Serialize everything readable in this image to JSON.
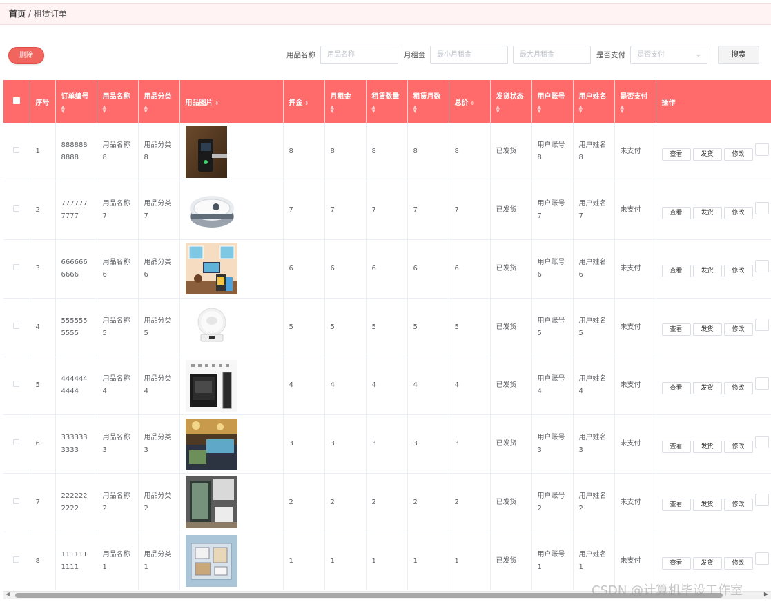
{
  "breadcrumb": {
    "home": "首页",
    "separator": " / ",
    "current": "租赁订单"
  },
  "toolbar": {
    "delete_label": "删除",
    "filters": [
      {
        "label": "用品名称",
        "placeholder": "用品名称"
      },
      {
        "label": "月租金",
        "min_placeholder": "最小月租金",
        "max_placeholder": "最大月租金"
      },
      {
        "label": "是否支付",
        "placeholder": "是否支付"
      }
    ],
    "search_label": "搜索"
  },
  "table": {
    "headers": [
      "序号",
      "订单编号",
      "用品名称",
      "用品分类",
      "用品图片",
      "押金",
      "月租金",
      "租赁数量",
      "租赁月数",
      "总价",
      "发货状态",
      "用户账号",
      "用户姓名",
      "是否支付",
      "操作"
    ],
    "actions": [
      "查看",
      "发货",
      "修改"
    ],
    "rows": [
      {
        "index": "1",
        "order_no": "8888888888",
        "name": "用品名称8",
        "category": "用品分类8",
        "image": "smart-door-lock",
        "deposit": "8",
        "monthly_rent": "8",
        "qty": "8",
        "months": "8",
        "total": "8",
        "ship_status": "已发货",
        "account": "用户账号8",
        "user_name": "用户姓名8",
        "paid": "未支付"
      },
      {
        "index": "2",
        "order_no": "7777777777",
        "name": "用品名称7",
        "category": "用品分类7",
        "image": "window-cleaning-robot",
        "deposit": "7",
        "monthly_rent": "7",
        "qty": "7",
        "months": "7",
        "total": "7",
        "ship_status": "已发货",
        "account": "用户账号7",
        "user_name": "用户姓名7",
        "paid": "未支付"
      },
      {
        "index": "3",
        "order_no": "6666666666",
        "name": "用品名称6",
        "category": "用品分类6",
        "image": "smart-home-illustration",
        "deposit": "6",
        "monthly_rent": "6",
        "qty": "6",
        "months": "6",
        "total": "6",
        "ship_status": "已发货",
        "account": "用户账号6",
        "user_name": "用户姓名6",
        "paid": "未支付"
      },
      {
        "index": "4",
        "order_no": "5555555555",
        "name": "用品名称5",
        "category": "用品分类5",
        "image": "smart-camera",
        "deposit": "5",
        "monthly_rent": "5",
        "qty": "5",
        "months": "5",
        "total": "5",
        "ship_status": "已发货",
        "account": "用户账号5",
        "user_name": "用户姓名5",
        "paid": "未支付"
      },
      {
        "index": "5",
        "order_no": "4444444444",
        "name": "用品名称4",
        "category": "用品分类4",
        "image": "smart-panel",
        "deposit": "4",
        "monthly_rent": "4",
        "qty": "4",
        "months": "4",
        "total": "4",
        "ship_status": "已发货",
        "account": "用户账号4",
        "user_name": "用户姓名4",
        "paid": "未支付"
      },
      {
        "index": "6",
        "order_no": "3333333333",
        "name": "用品名称3",
        "category": "用品分类3",
        "image": "showroom",
        "deposit": "3",
        "monthly_rent": "3",
        "qty": "3",
        "months": "3",
        "total": "3",
        "ship_status": "已发货",
        "account": "用户账号3",
        "user_name": "用户姓名3",
        "paid": "未支付"
      },
      {
        "index": "7",
        "order_no": "2222222222",
        "name": "用品名称2",
        "category": "用品分类2",
        "image": "bathroom",
        "deposit": "2",
        "monthly_rent": "2",
        "qty": "2",
        "months": "2",
        "total": "2",
        "ship_status": "已发货",
        "account": "用户账号2",
        "user_name": "用户姓名2",
        "paid": "未支付"
      },
      {
        "index": "8",
        "order_no": "1111111111",
        "name": "用品名称1",
        "category": "用品分类1",
        "image": "house-model",
        "deposit": "1",
        "monthly_rent": "1",
        "qty": "1",
        "months": "1",
        "total": "1",
        "ship_status": "已发货",
        "account": "用户账号1",
        "user_name": "用户姓名1",
        "paid": "未支付"
      }
    ]
  },
  "watermark": "CSDN @计算机毕设工作室",
  "colors": {
    "header_bg": "#ff6b6b",
    "delete_btn": "#f2645e",
    "breadcrumb_bg": "#fff3f3"
  }
}
